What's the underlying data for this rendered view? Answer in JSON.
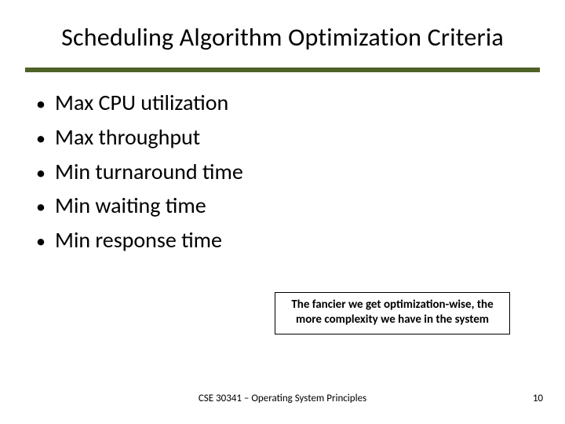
{
  "title": "Scheduling Algorithm Optimization Criteria",
  "bullets": [
    "Max CPU utilization",
    "Max throughput",
    "Min turnaround time",
    "Min waiting time",
    "Min response time"
  ],
  "callout": "The fancier we get optimization-wise, the more complexity we have in the system",
  "footer": {
    "course": "CSE 30341 – Operating System Principles",
    "page": "10"
  },
  "colors": {
    "divider": "#4f6228"
  }
}
